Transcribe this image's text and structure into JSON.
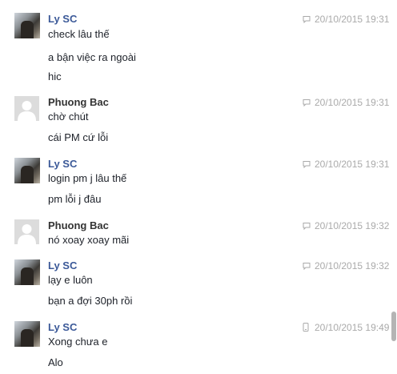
{
  "messages": [
    {
      "sender": "Ly SC",
      "avatar": "user-photo",
      "device_icon": "chat-bubble-icon",
      "timestamp": "20/10/2015 19:31",
      "lines": [
        "check lâu thế",
        "a bận việc ra ngoài",
        "hic"
      ]
    },
    {
      "sender": "Phuong Bac",
      "avatar": "default-user-silhouette",
      "device_icon": "chat-bubble-icon",
      "timestamp": "20/10/2015 19:31",
      "lines": [
        "chờ chút",
        "cái PM cứ lỗi"
      ]
    },
    {
      "sender": "Ly SC",
      "avatar": "user-photo",
      "device_icon": "chat-bubble-icon",
      "timestamp": "20/10/2015 19:31",
      "lines": [
        "login pm j lâu thế",
        "pm lỗi j đâu"
      ]
    },
    {
      "sender": "Phuong Bac",
      "avatar": "default-user-silhouette",
      "device_icon": "chat-bubble-icon",
      "timestamp": "20/10/2015 19:32",
      "lines": [
        "nó xoay xoay mãi"
      ]
    },
    {
      "sender": "Ly SC",
      "avatar": "user-photo",
      "device_icon": "chat-bubble-icon",
      "timestamp": "20/10/2015 19:32",
      "lines": [
        "lạy e luôn",
        "bạn a đợi 30ph rồi"
      ]
    },
    {
      "sender": "Ly SC",
      "avatar": "user-photo",
      "device_icon": "mobile-phone-icon",
      "timestamp": "20/10/2015 19:49",
      "lines": [
        "Xong chưa e",
        "Alo"
      ]
    }
  ],
  "colors": {
    "sender_link": "#3b5998",
    "sender_plain": "#333333",
    "text": "#1d2129",
    "meta": "#aaaaaa"
  }
}
